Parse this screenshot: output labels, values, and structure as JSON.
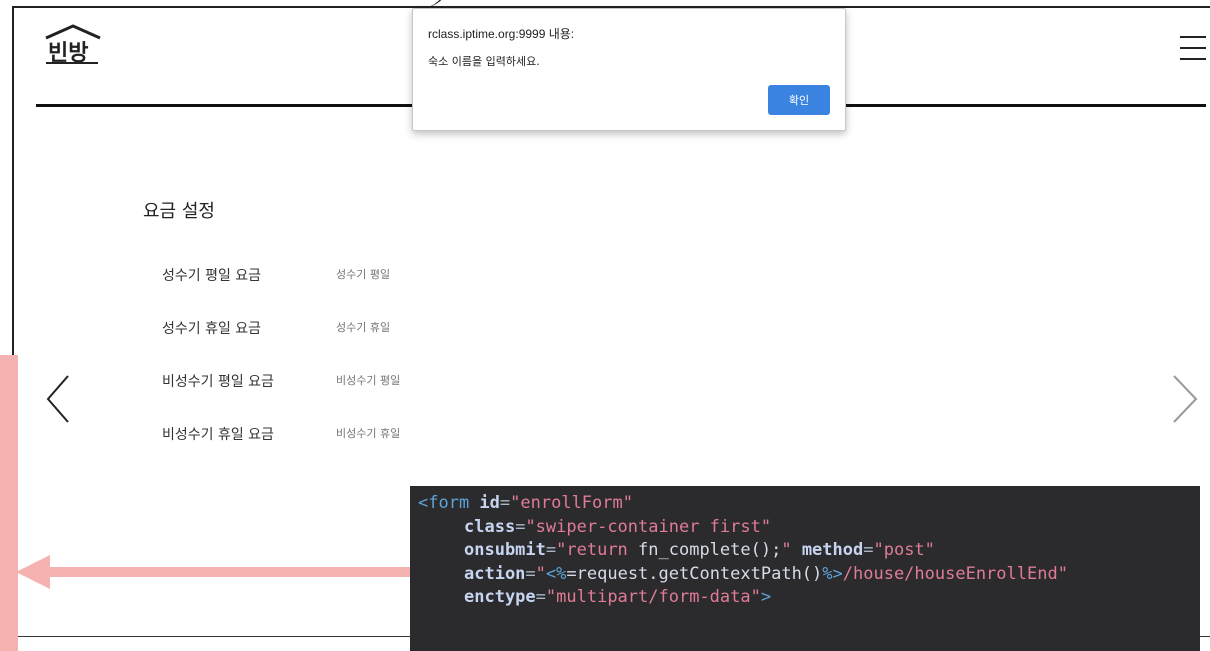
{
  "header": {
    "logo_icon": "house-logo-icon",
    "logo_text": "빈방",
    "menu_icon": "hamburger-menu-icon"
  },
  "dialog": {
    "title": "rclass.iptime.org:9999 내용:",
    "message": "숙소 이름을 입력하세요.",
    "ok_label": "확인",
    "ok_color": "#3b83e0"
  },
  "fees": {
    "title": "요금 설정",
    "rows": [
      {
        "label": "성수기 평일 요금",
        "placeholder": "성수기 평일"
      },
      {
        "label": "성수기 휴일 요금",
        "placeholder": "성수기 휴일"
      },
      {
        "label": "비성수기 평일 요금",
        "placeholder": "비성수기 평일"
      },
      {
        "label": "비성수기 휴일 요금",
        "placeholder": "비성수기 휴일"
      }
    ]
  },
  "navigation": {
    "prev_icon": "chevron-left-icon",
    "next_icon": "chevron-right-icon"
  },
  "annotation": {
    "arrow_color": "#f6b1b1",
    "arrow_icon": "arrow-left-icon"
  },
  "code": {
    "line1_open": "<form ",
    "line1_attr": "id",
    "line1_val": "\"enrollForm\"",
    "line2_attr": "class",
    "line2_val": "\"swiper-container first\"",
    "line3_attr": "onsubmit",
    "line3_val_a": "\"return ",
    "line3_fn": "fn_complete();",
    "line3_val_b": "\" ",
    "line3_attr2": "method",
    "line3_val2": "\"post\"",
    "line4_attr": "action",
    "line4_val_a": "\"",
    "line4_tag_a": "<%",
    "line4_val_b": "=request.getContextPath()",
    "line4_tag_b": "%>",
    "line4_val_c": "/house/houseEnrollEnd\"",
    "line5_attr": "enctype",
    "line5_val": "\"multipart/form-data\"",
    "line5_close": ">"
  }
}
